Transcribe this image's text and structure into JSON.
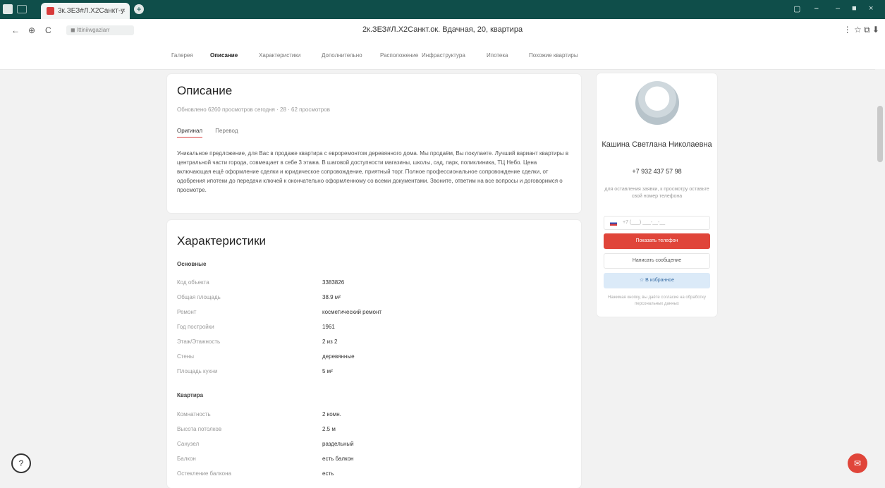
{
  "browser": {
    "tab_title": "3к.ЗЕЗ#Л.Х2Санкт-у",
    "tab_close": "×",
    "new_tab": "+",
    "window_controls": [
      "▢",
      "⎯",
      "‒",
      "■",
      "×"
    ],
    "url": "◼ Ittiniiwgaziarr",
    "page_title": "2к.ЗЕЗ#Л.Х2Санкт.ок. Вдачная, 20, квартира",
    "nav_icons": [
      "←",
      "⊕",
      "C"
    ],
    "right_icons": "⋮  ☆  ⧉  ⬇"
  },
  "site_nav": {
    "items": [
      {
        "label": "Галерея",
        "active": false
      },
      {
        "label": "Описание",
        "active": true
      },
      {
        "label": "Характеристики",
        "active": false
      },
      {
        "label": "Дополнительно",
        "active": false
      },
      {
        "label": "Расположение",
        "active": false
      },
      {
        "label": "Инфраструктура",
        "active": false
      },
      {
        "label": "Ипотека",
        "active": false
      },
      {
        "label": "Похожие квартиры",
        "active": false
      }
    ]
  },
  "description": {
    "title": "Описание",
    "meta": "Обновлено 6260 просмотров сегодня · 28 · 62 просмотров",
    "tabs": [
      "Оригинал",
      "Перевод"
    ],
    "text": "Уникальное предложение, для Вас в продаже квартира с евроремонтом деревянного дома. Мы продаём, Вы покупаете. Лучший вариант квартиры в центральной части города, совмещает в себе 3 этажа. В шаговой доступности магазины, школы, сад, парк, поликлиника, ТЦ Небо. Цена включающая ещё оформление сделки и юридическое сопровождение, приятный торг. Полное профессиональное сопровождение сделки, от одобрения ипотеки до передачи ключей к окончательно оформленному со всеми документами. Звоните, ответим на все вопросы и договоримся о просмотре."
  },
  "characteristics": {
    "title": "Характеристики",
    "groups": [
      {
        "name": "Основные",
        "rows": [
          {
            "key": "Код объекта",
            "value": "3383826"
          },
          {
            "key": "Общая площадь",
            "value": "38.9 м²"
          },
          {
            "key": "Ремонт",
            "value": "косметический ремонт"
          },
          {
            "key": "Год постройки",
            "value": "1961"
          },
          {
            "key": "Этаж/Этажность",
            "value": "2 из 2"
          },
          {
            "key": "Стены",
            "value": "деревянные"
          },
          {
            "key": "Площадь кухни",
            "value": "5 м²"
          }
        ]
      },
      {
        "name": "Квартира",
        "rows": [
          {
            "key": "Комнатность",
            "value": "2 комн."
          },
          {
            "key": "Высота потолков",
            "value": "2.5 м"
          },
          {
            "key": "Санузел",
            "value": "раздельный"
          },
          {
            "key": "Балкон",
            "value": "есть балкон"
          },
          {
            "key": "Остекление балкона",
            "value": "есть"
          }
        ]
      }
    ]
  },
  "agent": {
    "name": "Кашина Светлана Николаевна",
    "phone": "+7 932 437 57 98",
    "note": "для оставления заявки, к просмотру оставьте свой номер телефона",
    "phone_placeholder": "+7  (___) ___-__-__",
    "primary_button": "Показать телефон",
    "secondary_button": "Написать сообщение",
    "favorite_button": "☆  В избранное",
    "disclaimer": "Нажимая кнопку, вы даёте согласие на обработку персональных данных"
  },
  "floating": {
    "help_icon": "?",
    "chat_icon": "✉"
  }
}
